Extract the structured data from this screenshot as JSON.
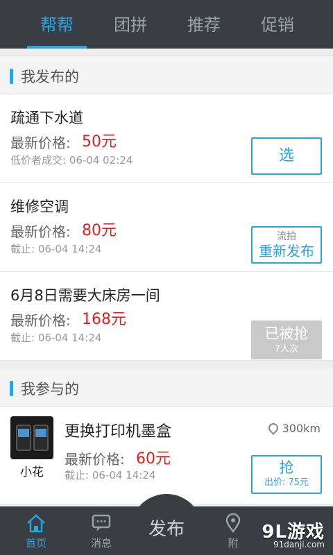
{
  "tabs": [
    {
      "label": "帮帮",
      "active": true
    },
    {
      "label": "团拼",
      "active": false
    },
    {
      "label": "推荐",
      "active": false
    },
    {
      "label": "促销",
      "active": false
    }
  ],
  "my_posts": {
    "title": "我发布的",
    "items": [
      {
        "name": "疏通下水道",
        "price_label": "最新价格:",
        "price": "50元",
        "sub": "低价者成交: 06-04  02:24",
        "button": "选"
      },
      {
        "name": "维修空调",
        "price_label": "最新价格:",
        "price": "80元",
        "sub": "截止: 06-04    14:24",
        "button_small": "流拍",
        "button_big": "重新发布"
      },
      {
        "name": "6月8日需要大床房一间",
        "price_label": "最新价格:",
        "price": "168元",
        "sub": "截止: 06-04    14:24",
        "button_big": "已被抢",
        "button_small": "7人次"
      }
    ]
  },
  "my_participation": {
    "title": "我参与的",
    "items": [
      {
        "user": "小花",
        "name": "更换打印机墨盒",
        "distance": "300km",
        "price_label": "最新价格:",
        "price": "60元",
        "sub": "截止: 06-04    14:24",
        "button_big": "抢",
        "button_small": "出价: 75元"
      }
    ]
  },
  "bottom_nav": {
    "home": "首页",
    "messages": "消息",
    "publish": "发布",
    "nearby": "附"
  },
  "watermark": {
    "logo": "9L游戏",
    "url": "91danji.com"
  },
  "colors": {
    "accent": "#2ba3dd",
    "price": "#e02020",
    "bar": "#3a3e44"
  }
}
